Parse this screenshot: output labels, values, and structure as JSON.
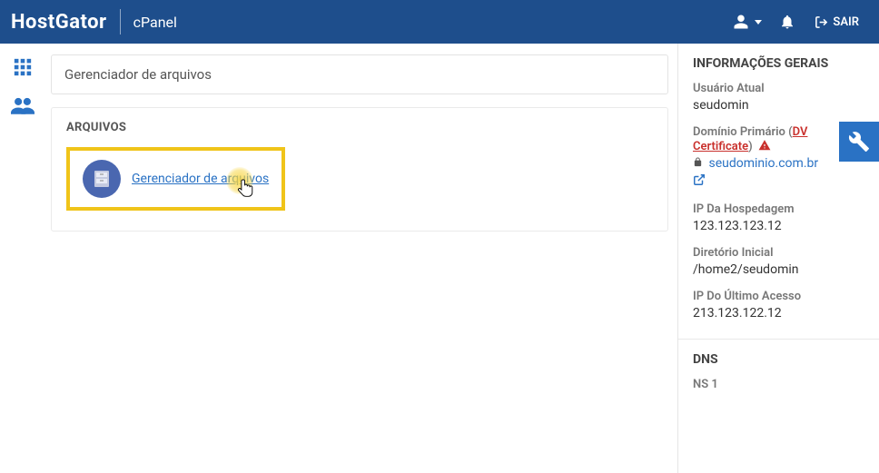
{
  "header": {
    "logo": "HostGator",
    "product": "cPanel",
    "logout_label": "SAIR"
  },
  "search": {
    "placeholder": "Gerenciador de arquivos"
  },
  "panel": {
    "title": "ARQUIVOS",
    "items": [
      {
        "label": "Gerenciador de arquivos"
      }
    ]
  },
  "sidebar": {
    "general": {
      "heading": "INFORMAÇÕES GERAIS",
      "user_label": "Usuário Atual",
      "user_value": "seudomin",
      "domain_label": "Domínio Primário",
      "dv_cert": "DV Certificate",
      "domain_value": "seudominio.com.br",
      "ip_label": "IP Da Hospedagem",
      "ip_value": "123.123.123.12",
      "home_label": "Diretório Inicial",
      "home_value": "/home2/seudomin",
      "lastip_label": "IP Do Último Acesso",
      "lastip_value": "213.123.122.12"
    },
    "dns": {
      "heading": "DNS",
      "ns1_label": "NS 1"
    }
  }
}
